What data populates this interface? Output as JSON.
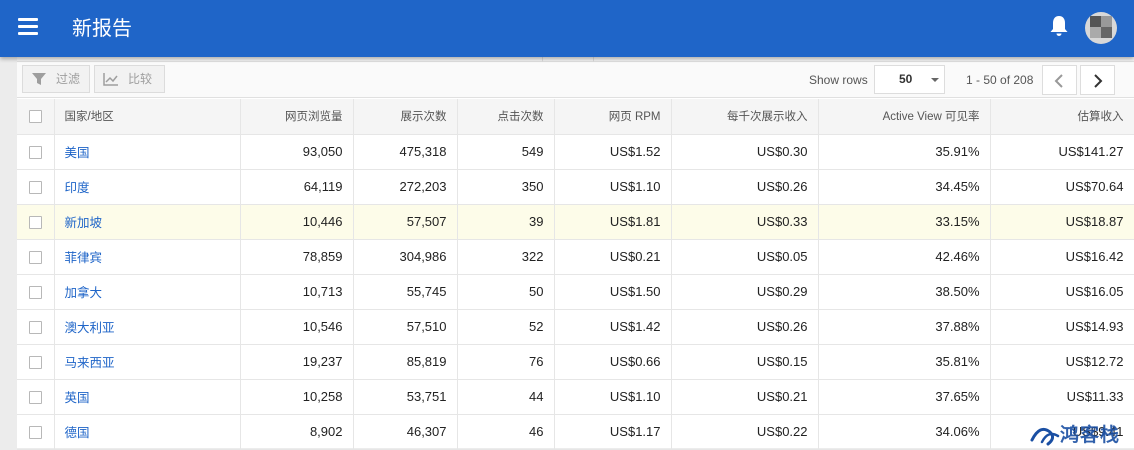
{
  "app": {
    "title": "新报告"
  },
  "toolbar": {
    "filter_label": "过滤",
    "compare_label": "比较",
    "show_rows_label": "Show rows",
    "rows_value": "50",
    "range_text": "1 - 50 of 208"
  },
  "table": {
    "headers": [
      "国家/地区",
      "网页浏览量",
      "展示次数",
      "点击次数",
      "网页 RPM",
      "每千次展示收入",
      "Active View 可见率",
      "估算收入"
    ],
    "rows": [
      {
        "country": "美国",
        "pageviews": "93,050",
        "impressions": "475,318",
        "clicks": "549",
        "rpm": "US$1.52",
        "ecpm": "US$0.30",
        "viewability": "35.91%",
        "revenue": "US$141.27"
      },
      {
        "country": "印度",
        "pageviews": "64,119",
        "impressions": "272,203",
        "clicks": "350",
        "rpm": "US$1.10",
        "ecpm": "US$0.26",
        "viewability": "34.45%",
        "revenue": "US$70.64"
      },
      {
        "country": "新加坡",
        "pageviews": "10,446",
        "impressions": "57,507",
        "clicks": "39",
        "rpm": "US$1.81",
        "ecpm": "US$0.33",
        "viewability": "33.15%",
        "revenue": "US$18.87"
      },
      {
        "country": "菲律宾",
        "pageviews": "78,859",
        "impressions": "304,986",
        "clicks": "322",
        "rpm": "US$0.21",
        "ecpm": "US$0.05",
        "viewability": "42.46%",
        "revenue": "US$16.42"
      },
      {
        "country": "加拿大",
        "pageviews": "10,713",
        "impressions": "55,745",
        "clicks": "50",
        "rpm": "US$1.50",
        "ecpm": "US$0.29",
        "viewability": "38.50%",
        "revenue": "US$16.05"
      },
      {
        "country": "澳大利亚",
        "pageviews": "10,546",
        "impressions": "57,510",
        "clicks": "52",
        "rpm": "US$1.42",
        "ecpm": "US$0.26",
        "viewability": "37.88%",
        "revenue": "US$14.93"
      },
      {
        "country": "马来西亚",
        "pageviews": "19,237",
        "impressions": "85,819",
        "clicks": "76",
        "rpm": "US$0.66",
        "ecpm": "US$0.15",
        "viewability": "35.81%",
        "revenue": "US$12.72"
      },
      {
        "country": "英国",
        "pageviews": "10,258",
        "impressions": "53,751",
        "clicks": "44",
        "rpm": "US$1.10",
        "ecpm": "US$0.21",
        "viewability": "37.65%",
        "revenue": "US$11.33"
      },
      {
        "country": "德国",
        "pageviews": "8,902",
        "impressions": "46,307",
        "clicks": "46",
        "rpm": "US$1.17",
        "ecpm": "US$0.22",
        "viewability": "34.06%",
        "revenue": "US$9.41"
      }
    ]
  },
  "watermark": {
    "text": "鸿客栈"
  },
  "colors": {
    "appbar": "#1f65c8",
    "link": "#1f65c8",
    "highlight_row": "#fdfce9"
  }
}
